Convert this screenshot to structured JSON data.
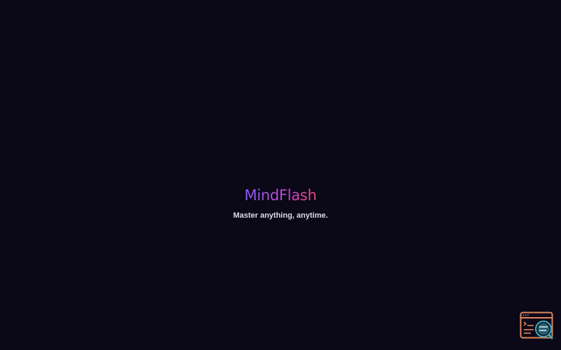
{
  "app": {
    "title": "MindFlash",
    "tagline": "Master anything, anytime."
  },
  "devtools": {
    "icon": "devtools-inspector-icon"
  },
  "colors": {
    "background": "#0b0818",
    "title_gradient_start": "#8a5cf6",
    "title_gradient_end": "#e8467c",
    "tagline": "#ddd8ec",
    "devtools_frame": "#e0855c",
    "devtools_lens": "#3aa6b9"
  }
}
